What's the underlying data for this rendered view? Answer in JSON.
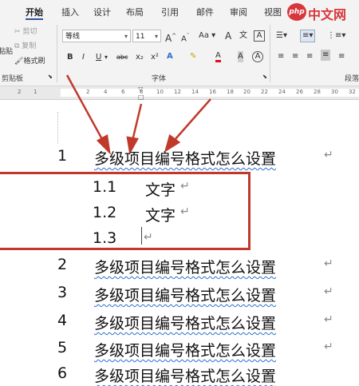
{
  "tabs": [
    "开始",
    "插入",
    "设计",
    "布局",
    "引用",
    "邮件",
    "审阅",
    "视图"
  ],
  "watermark": "中文网",
  "watermark_badge": "php",
  "clipboard": {
    "cut": "剪切",
    "copy": "复制",
    "paste": "粘贴",
    "format_painter": "格式刷",
    "label": "剪贴板"
  },
  "font": {
    "name": "等线",
    "size": "11",
    "label": "字体",
    "bold": "B",
    "italic": "I",
    "underline": "U",
    "strike": "abc",
    "sub": "x₂",
    "sup": "x²",
    "grow": "A",
    "shrink": "A",
    "case": "Aa",
    "clear": "A",
    "wen": "文",
    "a_color": "A",
    "char_shade": "A",
    "enclose": "A"
  },
  "paragraph": {
    "label": "段落"
  },
  "ruler_numbers": [
    "2",
    "1",
    "2",
    "4",
    "6",
    "8",
    "10",
    "12",
    "14",
    "16",
    "18",
    "20",
    "22",
    "24",
    "26",
    "28",
    "30",
    "32"
  ],
  "document": {
    "lines": [
      {
        "num": "1",
        "text": "多级项目编号格式怎么设置"
      },
      {
        "num": "1.1",
        "text": "文字"
      },
      {
        "num": "1.2",
        "text": "文字"
      },
      {
        "num": "1.3",
        "text": ""
      },
      {
        "num": "2",
        "text": "多级项目编号格式怎么设置"
      },
      {
        "num": "3",
        "text": "多级项目编号格式怎么设置"
      },
      {
        "num": "4",
        "text": "多级项目编号格式怎么设置"
      },
      {
        "num": "5",
        "text": "多级项目编号格式怎么设置"
      },
      {
        "num": "6",
        "text": "多级项目编号格式怎么设置"
      }
    ],
    "para_mark": "↵"
  },
  "colors": {
    "annotation": "#c0392b",
    "accent": "#2b579a"
  }
}
